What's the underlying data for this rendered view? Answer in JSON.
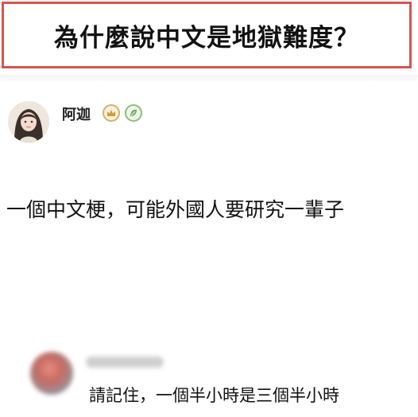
{
  "header": {
    "title": "為什麼說中文是地獄難度？"
  },
  "comment": {
    "author": "阿迦",
    "badges": [
      "crown-badge-icon",
      "leaf-badge-icon"
    ],
    "text": "一個中文梗，可能外國人要研究一輩子"
  },
  "reply": {
    "text": "請記住，一個半小時是三個半小時"
  },
  "colors": {
    "title_border": "#d9534f",
    "crown_badge": "#d8b068",
    "leaf_badge": "#8cbf7a"
  }
}
